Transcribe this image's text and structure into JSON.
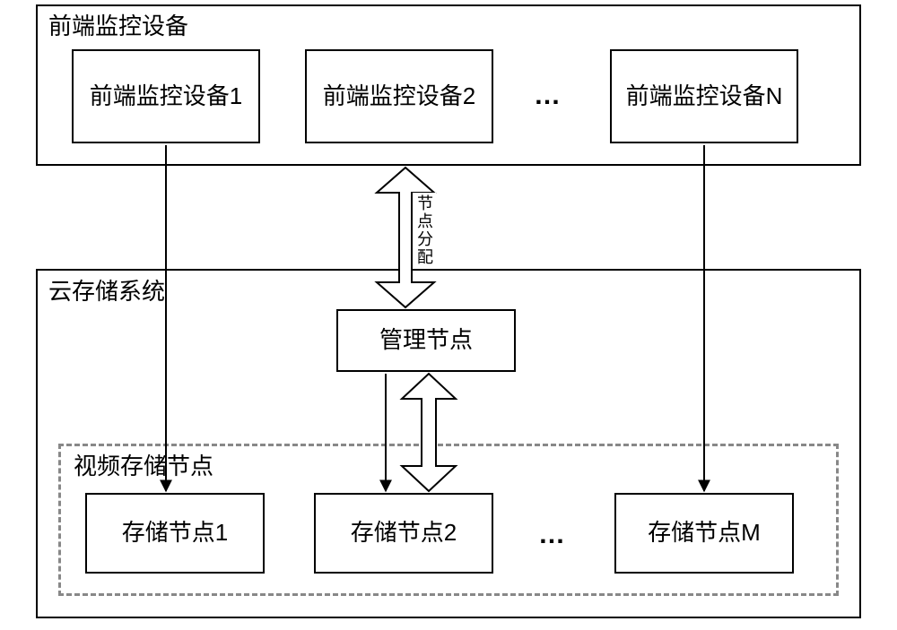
{
  "top_group": {
    "title": "前端监控设备",
    "devices": [
      "前端监控设备1",
      "前端监控设备2",
      "前端监控设备N"
    ],
    "ellipsis": "…"
  },
  "middle_label": "节点分配",
  "bottom_group": {
    "title": "云存储系统",
    "manager": "管理节点",
    "storage_group_title": "视频存储节点",
    "nodes": [
      "存储节点1",
      "存储节点2",
      "存储节点M"
    ],
    "ellipsis": "…"
  }
}
